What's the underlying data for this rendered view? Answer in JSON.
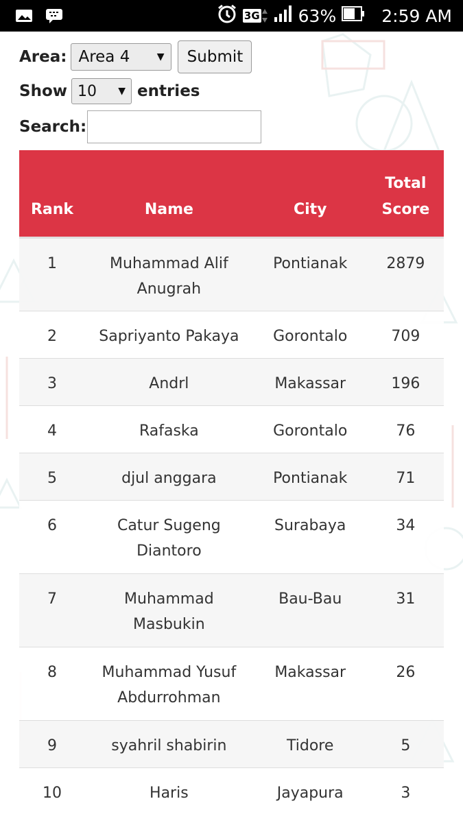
{
  "status_bar": {
    "battery_percent": "63%",
    "network": "3G",
    "time": "2:59 AM"
  },
  "filters": {
    "area_label": "Area:",
    "area_selected": "Area 4",
    "submit_label": "Submit",
    "show_label": "Show",
    "entries_selected": "10",
    "entries_label": "entries",
    "search_label": "Search:",
    "search_value": ""
  },
  "table": {
    "headers": {
      "rank": "Rank",
      "name": "Name",
      "city": "City",
      "score": "Total Score"
    },
    "rows": [
      {
        "rank": "1",
        "name": "Muhammad Alif Anugrah",
        "city": "Pontianak",
        "score": "2879"
      },
      {
        "rank": "2",
        "name": "Sapriyanto Pakaya",
        "city": "Gorontalo",
        "score": "709"
      },
      {
        "rank": "3",
        "name": "Andrl",
        "city": "Makassar",
        "score": "196"
      },
      {
        "rank": "4",
        "name": "Rafaska",
        "city": "Gorontalo",
        "score": "76"
      },
      {
        "rank": "5",
        "name": "djul anggara",
        "city": "Pontianak",
        "score": "71"
      },
      {
        "rank": "6",
        "name": "Catur Sugeng Diantoro",
        "city": "Surabaya",
        "score": "34"
      },
      {
        "rank": "7",
        "name": "Muhammad Masbukin",
        "city": "Bau-Bau",
        "score": "31"
      },
      {
        "rank": "8",
        "name": "Muhammad Yusuf Abdurrohman",
        "city": "Makassar",
        "score": "26"
      },
      {
        "rank": "9",
        "name": "syahril shabirin",
        "city": "Tidore",
        "score": "5"
      },
      {
        "rank": "10",
        "name": "Haris",
        "city": "Jayapura",
        "score": "3"
      }
    ]
  },
  "colors": {
    "header_bg": "#dc3545",
    "status_bar_bg": "#000000"
  },
  "icons": [
    "gallery-icon",
    "bbm-icon",
    "alarm-icon",
    "network-3g-icon",
    "signal-icon",
    "battery-icon",
    "dropdown-caret-icon"
  ]
}
